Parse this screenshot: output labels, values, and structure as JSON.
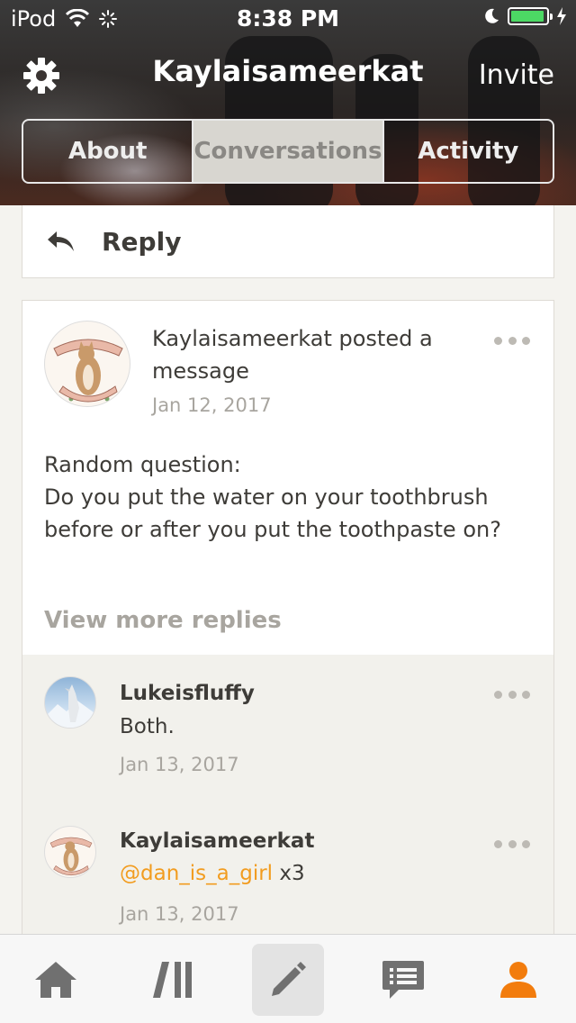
{
  "status_bar": {
    "carrier": "iPod",
    "time": "8:38 PM"
  },
  "nav": {
    "title": "Kaylaisameerkat",
    "invite_label": "Invite",
    "settings_icon": "gear-icon"
  },
  "tabs": [
    {
      "label": "About",
      "active": false
    },
    {
      "label": "Conversations",
      "active": true
    },
    {
      "label": "Activity",
      "active": false
    }
  ],
  "reply_bar": {
    "label": "Reply",
    "icon": "reply-arrow-icon"
  },
  "post": {
    "author": "Kaylaisameerkat",
    "action_line1": "Kaylaisameerkat posted a",
    "action_line2": "message",
    "date": "Jan 12, 2017",
    "body_line1": "Random question:",
    "body_line2": "Do you put the water on your toothbrush",
    "body_line3": "before or after you put the toothpaste on?",
    "view_more": "View more replies"
  },
  "replies": [
    {
      "name": "Lukeisfluffy",
      "text": "Both.",
      "date": "Jan 13, 2017"
    },
    {
      "name": "Kaylaisameerkat",
      "mention": "@dan_is_a_girl",
      "text": " x3",
      "date": "Jan 13, 2017"
    }
  ],
  "tabbar": [
    {
      "icon": "home-icon",
      "selected": false
    },
    {
      "icon": "library-icon",
      "selected": false
    },
    {
      "icon": "compose-pencil-icon",
      "selected": true
    },
    {
      "icon": "chat-icon",
      "selected": false
    },
    {
      "icon": "profile-icon",
      "selected": false,
      "color": "#f27c0d"
    }
  ],
  "colors": {
    "accent": "#f27c0d",
    "mention": "#f29c1f",
    "battery": "#4cd964"
  }
}
